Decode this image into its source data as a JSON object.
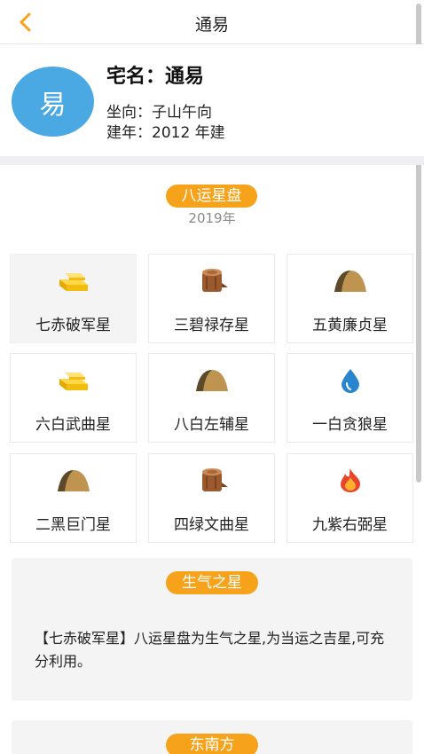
{
  "header": {
    "title": "通易",
    "back_icon": "chevron-left-icon",
    "accent": "#f7a21b"
  },
  "house": {
    "avatar_char": "易",
    "name": "宅名：通易",
    "direction": "坐向：子山午向",
    "built_year": "建年：2012 年建"
  },
  "star_chart": {
    "title": "八运星盘",
    "year": "2019年",
    "cells": [
      {
        "label": "七赤破军星",
        "icon": "gold-bar-icon",
        "selected": true
      },
      {
        "label": "三碧禄存星",
        "icon": "wood-stump-icon"
      },
      {
        "label": "五黄廉贞星",
        "icon": "earth-mound-icon"
      },
      {
        "label": "六白武曲星",
        "icon": "gold-bar-icon"
      },
      {
        "label": "八白左辅星",
        "icon": "earth-mound-icon"
      },
      {
        "label": "一白贪狼星",
        "icon": "water-drop-icon"
      },
      {
        "label": "二黑巨门星",
        "icon": "earth-mound-icon"
      },
      {
        "label": "四绿文曲星",
        "icon": "wood-stump-icon"
      },
      {
        "label": "九紫右弼星",
        "icon": "fire-icon"
      }
    ]
  },
  "info_card": {
    "title": "生气之星",
    "text": "【七赤破军星】八运星盘为生气之星,为当运之吉星,可充分利用。"
  },
  "next_card": {
    "title": "东南方"
  }
}
